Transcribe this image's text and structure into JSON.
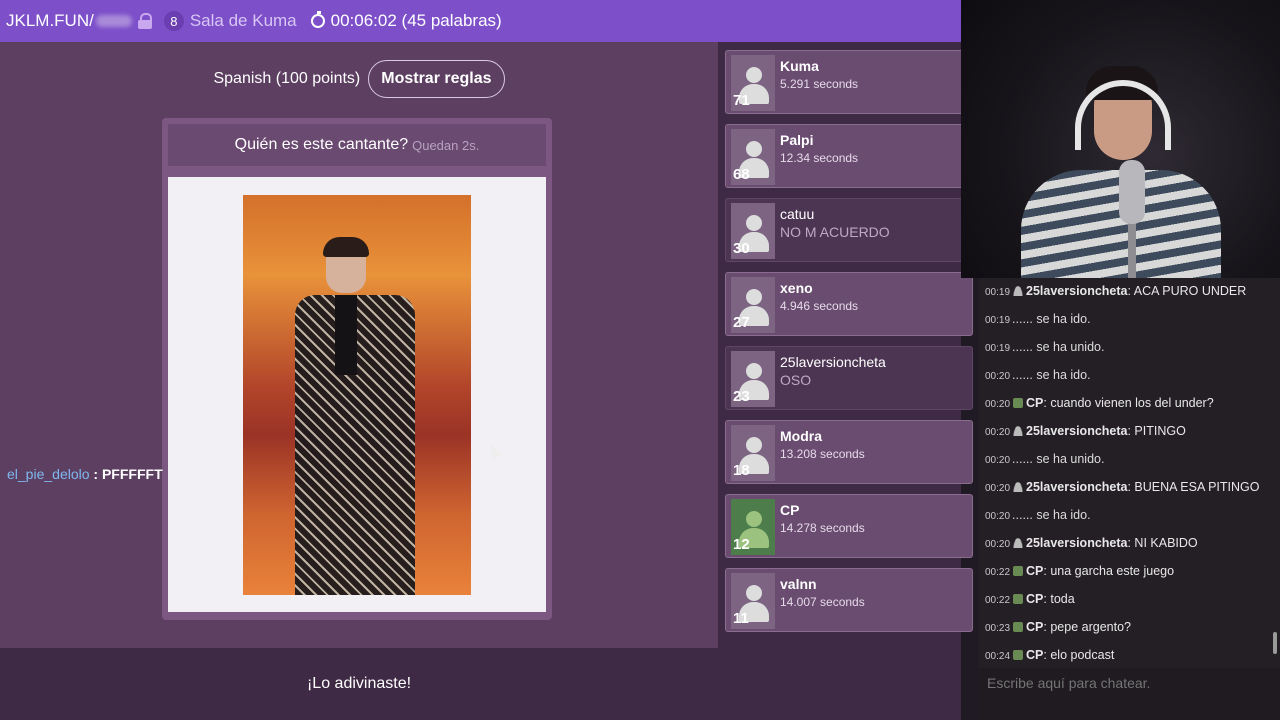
{
  "topbar": {
    "site": "JKLM.FUN/",
    "player_count": "8",
    "room": "Sala de Kuma",
    "timer": "00:06:02 (45 palabras)"
  },
  "game": {
    "language": "Spanish (100 points)",
    "rules_button": "Mostrar reglas",
    "question": "Quién es este cantante?",
    "remaining": "Quedan 2s.",
    "bottom_text": "¡Lo adivinaste!",
    "inline_chat": {
      "user": "el_pie_delolo",
      "message": ": PFFFFFT"
    }
  },
  "players": [
    {
      "name": "Kuma",
      "status": "5.291 seconds",
      "score": "71",
      "dim": false
    },
    {
      "name": "Palpi",
      "status": "12.34 seconds",
      "score": "68",
      "dim": false
    },
    {
      "name": "catuu",
      "status": "NO M ACUERDO",
      "score": "30",
      "dim": true
    },
    {
      "name": "xeno",
      "status": "4.946 seconds",
      "score": "27",
      "dim": false
    },
    {
      "name": "25laversioncheta",
      "status": "OSO",
      "score": "23",
      "dim": true
    },
    {
      "name": "Modra",
      "status": "13.208 seconds",
      "score": "18",
      "dim": false
    },
    {
      "name": "CP",
      "status": "14.278 seconds",
      "score": "12",
      "dim": false
    },
    {
      "name": "valnn",
      "status": "14.007 seconds",
      "score": "11",
      "dim": false
    }
  ],
  "chat": {
    "lines": [
      {
        "time": "00:19",
        "icon": "person",
        "user": "25laversioncheta",
        "text": ": ACA PURO UNDER"
      },
      {
        "time": "00:19",
        "icon": "",
        "user": "",
        "text": "...... se ha ido."
      },
      {
        "time": "00:19",
        "icon": "",
        "user": "",
        "text": "...... se ha unido."
      },
      {
        "time": "00:20",
        "icon": "",
        "user": "",
        "text": "...... se ha ido."
      },
      {
        "time": "00:20",
        "icon": "cp",
        "user": "CP",
        "text": ": cuando vienen los del under?"
      },
      {
        "time": "00:20",
        "icon": "person",
        "user": "25laversioncheta",
        "text": ": PITINGO"
      },
      {
        "time": "00:20",
        "icon": "",
        "user": "",
        "text": "...... se ha unido."
      },
      {
        "time": "00:20",
        "icon": "person",
        "user": "25laversioncheta",
        "text": ": BUENA ESA PITINGO"
      },
      {
        "time": "00:20",
        "icon": "",
        "user": "",
        "text": "...... se ha ido."
      },
      {
        "time": "00:20",
        "icon": "person",
        "user": "25laversioncheta",
        "text": ": NI KABIDO"
      },
      {
        "time": "00:22",
        "icon": "cp",
        "user": "CP",
        "text": ": una garcha este juego"
      },
      {
        "time": "00:22",
        "icon": "cp",
        "user": "CP",
        "text": ": toda"
      },
      {
        "time": "00:23",
        "icon": "cp",
        "user": "CP",
        "text": ": pepe argento?"
      },
      {
        "time": "00:24",
        "icon": "cp",
        "user": "CP",
        "text": ": elo podcast"
      }
    ],
    "input_placeholder": "Escribe aquí para chatear."
  }
}
